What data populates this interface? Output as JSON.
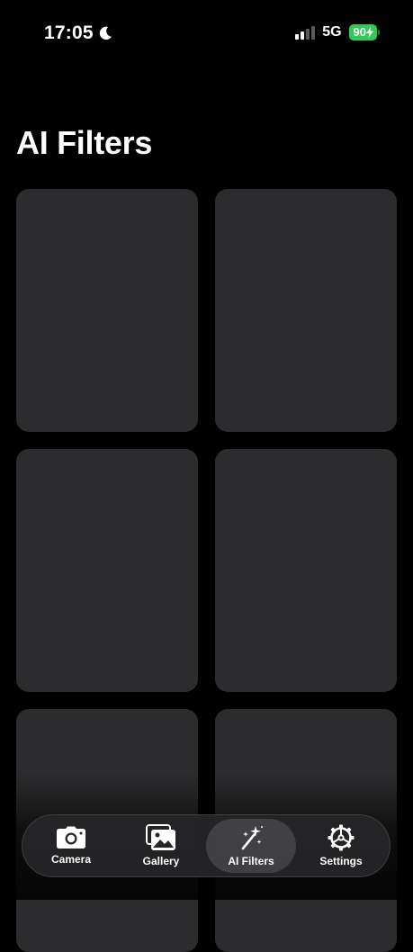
{
  "status_bar": {
    "time": "17:05",
    "network": "5G",
    "battery_level": "90"
  },
  "page": {
    "title": "AI Filters"
  },
  "filters": {
    "visible_cards": 6
  },
  "tab_bar": {
    "tabs": [
      {
        "label": "Camera",
        "icon": "camera-icon",
        "active": false
      },
      {
        "label": "Gallery",
        "icon": "gallery-icon",
        "active": false
      },
      {
        "label": "AI Filters",
        "icon": "magic-wand-icon",
        "active": true
      },
      {
        "label": "Settings",
        "icon": "gear-icon",
        "active": false
      }
    ]
  },
  "colors": {
    "background": "#000000",
    "card": "#2c2c2e",
    "battery": "#34c759",
    "tab_bar": "#262628"
  }
}
